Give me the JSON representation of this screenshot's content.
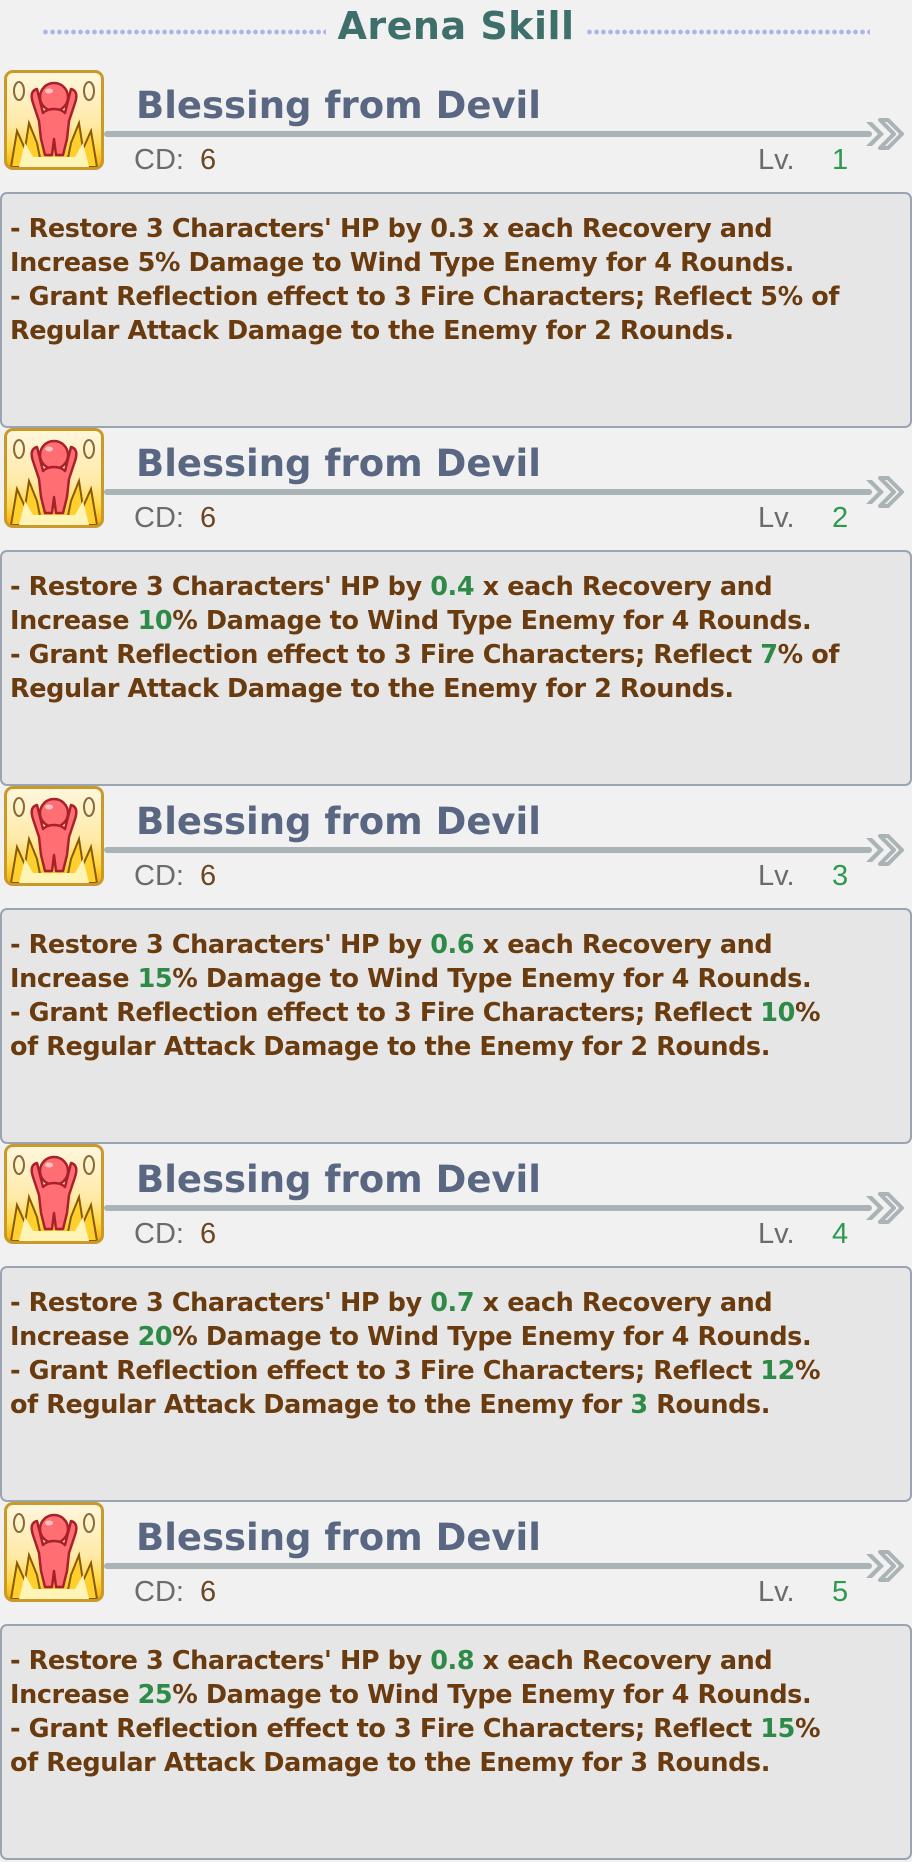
{
  "header": {
    "title": "Arena Skill"
  },
  "colors": {
    "text_brown": "#6a3b0f",
    "highlight_green": "#2e8b47",
    "title_teal": "#3f6f6a",
    "skill_name": "#5a6782"
  },
  "labels": {
    "cd": "CD:",
    "lv": "Lv."
  },
  "skills": [
    {
      "icon": "red-character-power-icon",
      "name": "Blessing from Devil",
      "cd": "6",
      "level": "1",
      "lines": [
        [
          {
            "t": "- Restore 3 Characters' HP by 0.3 x each Recovery and",
            "h": false
          }
        ],
        [
          {
            "t": "Increase 5% Damage to Wind Type Enemy for 4 Rounds.",
            "h": false
          }
        ],
        [
          {
            "t": "- Grant Reflection effect to 3 Fire Characters; Reflect 5% of",
            "h": false
          }
        ],
        [
          {
            "t": "Regular Attack Damage to the Enemy for 2 Rounds.",
            "h": false
          }
        ]
      ]
    },
    {
      "icon": "red-character-power-icon",
      "name": "Blessing from Devil",
      "cd": "6",
      "level": "2",
      "lines": [
        [
          {
            "t": "- Restore 3 Characters' HP by ",
            "h": false
          },
          {
            "t": "0.4",
            "h": true
          },
          {
            "t": " x each Recovery and",
            "h": false
          }
        ],
        [
          {
            "t": "Increase ",
            "h": false
          },
          {
            "t": "10",
            "h": true
          },
          {
            "t": "% Damage to Wind Type Enemy for 4 Rounds.",
            "h": false
          }
        ],
        [
          {
            "t": "- Grant Reflection effect to 3 Fire Characters; Reflect ",
            "h": false
          },
          {
            "t": "7",
            "h": true
          },
          {
            "t": "% of",
            "h": false
          }
        ],
        [
          {
            "t": "Regular Attack Damage to the Enemy for 2 Rounds.",
            "h": false
          }
        ]
      ]
    },
    {
      "icon": "red-character-power-icon",
      "name": "Blessing from Devil",
      "cd": "6",
      "level": "3",
      "lines": [
        [
          {
            "t": "- Restore 3 Characters' HP by ",
            "h": false
          },
          {
            "t": "0.6",
            "h": true
          },
          {
            "t": " x each Recovery and",
            "h": false
          }
        ],
        [
          {
            "t": "Increase ",
            "h": false
          },
          {
            "t": "15",
            "h": true
          },
          {
            "t": "% Damage to Wind Type Enemy for 4 Rounds.",
            "h": false
          }
        ],
        [
          {
            "t": "- Grant Reflection effect to 3 Fire Characters; Reflect ",
            "h": false
          },
          {
            "t": "10",
            "h": true
          },
          {
            "t": "%",
            "h": false
          }
        ],
        [
          {
            "t": "of Regular Attack Damage to the Enemy for 2 Rounds.",
            "h": false
          }
        ]
      ]
    },
    {
      "icon": "red-character-power-icon",
      "name": "Blessing from Devil",
      "cd": "6",
      "level": "4",
      "lines": [
        [
          {
            "t": "- Restore 3 Characters' HP by ",
            "h": false
          },
          {
            "t": "0.7",
            "h": true
          },
          {
            "t": " x each Recovery and",
            "h": false
          }
        ],
        [
          {
            "t": "Increase ",
            "h": false
          },
          {
            "t": "20",
            "h": true
          },
          {
            "t": "% Damage to Wind Type Enemy for 4 Rounds.",
            "h": false
          }
        ],
        [
          {
            "t": "- Grant Reflection effect to 3 Fire Characters; Reflect ",
            "h": false
          },
          {
            "t": "12",
            "h": true
          },
          {
            "t": "%",
            "h": false
          }
        ],
        [
          {
            "t": "of Regular Attack Damage to the Enemy for ",
            "h": false
          },
          {
            "t": "3",
            "h": true
          },
          {
            "t": " Rounds.",
            "h": false
          }
        ]
      ]
    },
    {
      "icon": "red-character-power-icon",
      "name": "Blessing from Devil",
      "cd": "6",
      "level": "5",
      "lines": [
        [
          {
            "t": "- Restore 3 Characters' HP by ",
            "h": false
          },
          {
            "t": "0.8",
            "h": true
          },
          {
            "t": " x each Recovery and",
            "h": false
          }
        ],
        [
          {
            "t": "Increase ",
            "h": false
          },
          {
            "t": "25",
            "h": true
          },
          {
            "t": "% Damage to Wind Type Enemy for 4 Rounds.",
            "h": false
          }
        ],
        [
          {
            "t": "- Grant Reflection effect to 3 Fire Characters; Reflect ",
            "h": false
          },
          {
            "t": "15",
            "h": true
          },
          {
            "t": "%",
            "h": false
          }
        ],
        [
          {
            "t": "of Regular Attack Damage to the Enemy for 3 Rounds.",
            "h": false
          }
        ]
      ]
    }
  ]
}
